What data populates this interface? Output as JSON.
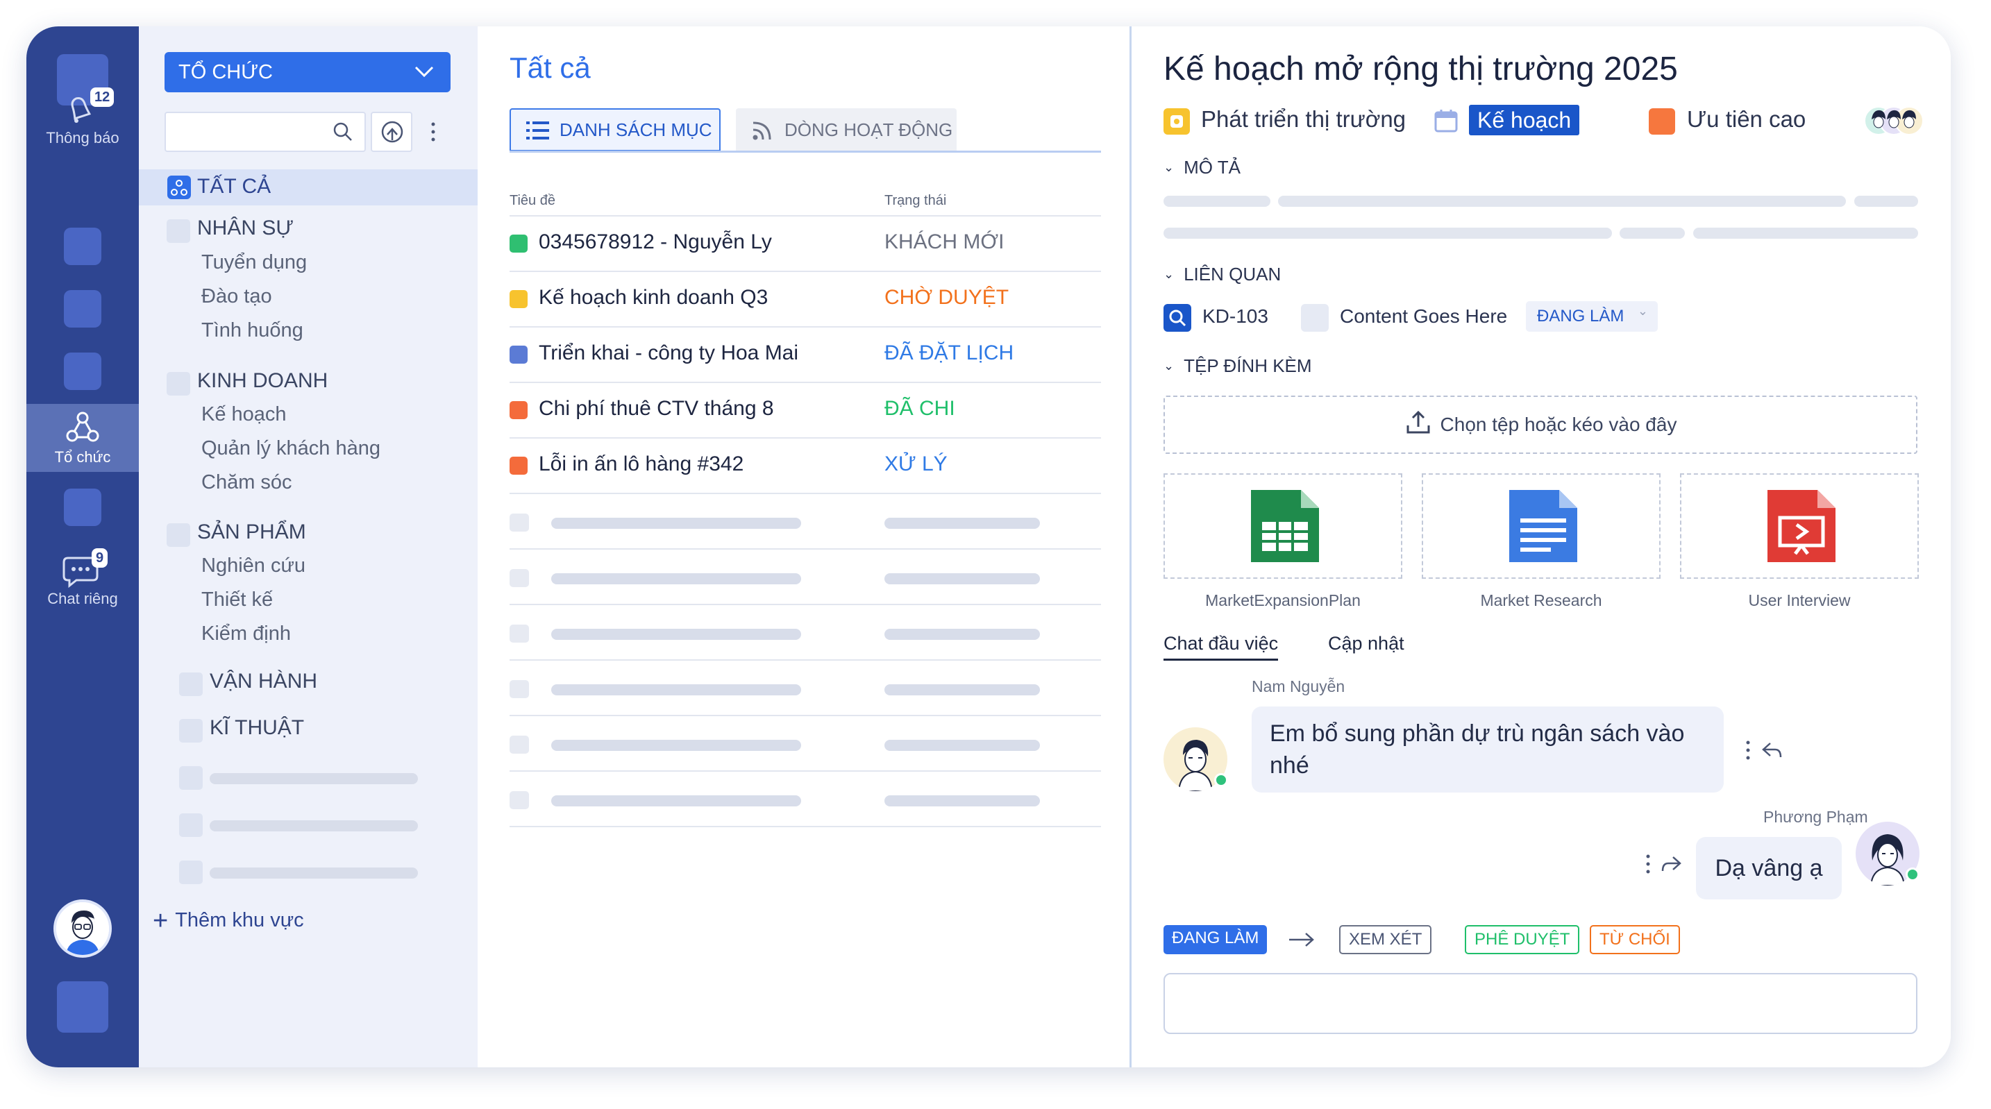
{
  "rail": {
    "notifications_label": "Thông báo",
    "notifications_count": "12",
    "org_label": "Tổ chức",
    "chat_label": "Chat riêng",
    "chat_count": "9"
  },
  "sidebar": {
    "org_select": "TỔ CHỨC",
    "all_label": "TẤT CẢ",
    "groups": [
      {
        "title": "NHÂN SỰ",
        "items": [
          "Tuyển dụng",
          "Đào tạo",
          "Tình huống"
        ]
      },
      {
        "title": "KINH DOANH",
        "items": [
          "Kế hoạch",
          "Quản lý khách hàng",
          "Chăm sóc"
        ]
      },
      {
        "title": "SẢN PHẨM",
        "items": [
          "Nghiên cứu",
          "Thiết kế",
          "Kiểm định"
        ]
      },
      {
        "title": "VẬN HÀNH",
        "items": []
      },
      {
        "title": "KĨ THUẬT",
        "items": []
      }
    ],
    "add_area": "Thêm khu vực"
  },
  "list": {
    "title": "Tất cả",
    "tab_list": "DANH SÁCH MỤC",
    "tab_stream": "DÒNG HOẠT ĐỘNG",
    "col_title": "Tiêu đề",
    "col_status": "Trạng thái",
    "rows": [
      {
        "title": "0345678912 - Nguyễn Ly",
        "status": "KHÁCH MỚI",
        "status_color": "#6b7080",
        "icon_color": "#2fbf71"
      },
      {
        "title": "Kế hoạch kinh doanh Q3",
        "status": "CHỜ DUYỆT",
        "status_color": "#f2711c",
        "icon_color": "#f7c32e"
      },
      {
        "title": "Triển khai - công ty Hoa Mai",
        "status": "ĐÃ ĐẶT LỊCH",
        "status_color": "#2f7ae5",
        "icon_color": "#5b7bd5"
      },
      {
        "title": "Chi phí thuê CTV tháng 8",
        "status": "ĐÃ CHI",
        "status_color": "#1fbf6a",
        "icon_color": "#f46b3b"
      },
      {
        "title": "Lỗi in ấn lô hàng #342",
        "status": "XỬ LÝ",
        "status_color": "#2f7ae5",
        "icon_color": "#f46b3b"
      }
    ]
  },
  "detail": {
    "title": "Kế hoạch mở rộng thị trường 2025",
    "category": "Phát triển thị trường",
    "tag": "Kế hoạch",
    "priority": "Ưu tiên cao",
    "sec_description": "MÔ TẢ",
    "sec_related": "LIÊN QUAN",
    "related_id": "KD-103",
    "related_name": "Content Goes Here",
    "related_status": "ĐANG LÀM",
    "sec_attachments": "TỆP ĐÍNH KÈM",
    "upload_text": "Chọn tệp hoặc kéo vào đây",
    "files": [
      {
        "name": "MarketExpansionPlan",
        "icon": "spreadsheet-icon",
        "color": "#1f8b4c"
      },
      {
        "name": "Market Research",
        "icon": "document-icon",
        "color": "#3b7be2"
      },
      {
        "name": "User Interview",
        "icon": "presentation-icon",
        "color": "#e03b35"
      }
    ],
    "tab_chat": "Chat đầu việc",
    "tab_updates": "Cập nhật",
    "messages": [
      {
        "sender": "Nam Nguyễn",
        "text_line1": "Em bổ sung phần dự trù ngân sách vào",
        "text_line2": "nhé"
      },
      {
        "sender": "Phương Phạm",
        "text": "Dạ vâng ạ"
      }
    ],
    "workflow": {
      "current": "ĐANG LÀM",
      "review": "XEM XÉT",
      "approve": "PHÊ DUYỆT",
      "reject": "TỪ CHỐI"
    }
  },
  "colors": {
    "rail": "#2e4591",
    "accent": "#2f6ee8",
    "sidebar_bg": "#eef1fa"
  }
}
